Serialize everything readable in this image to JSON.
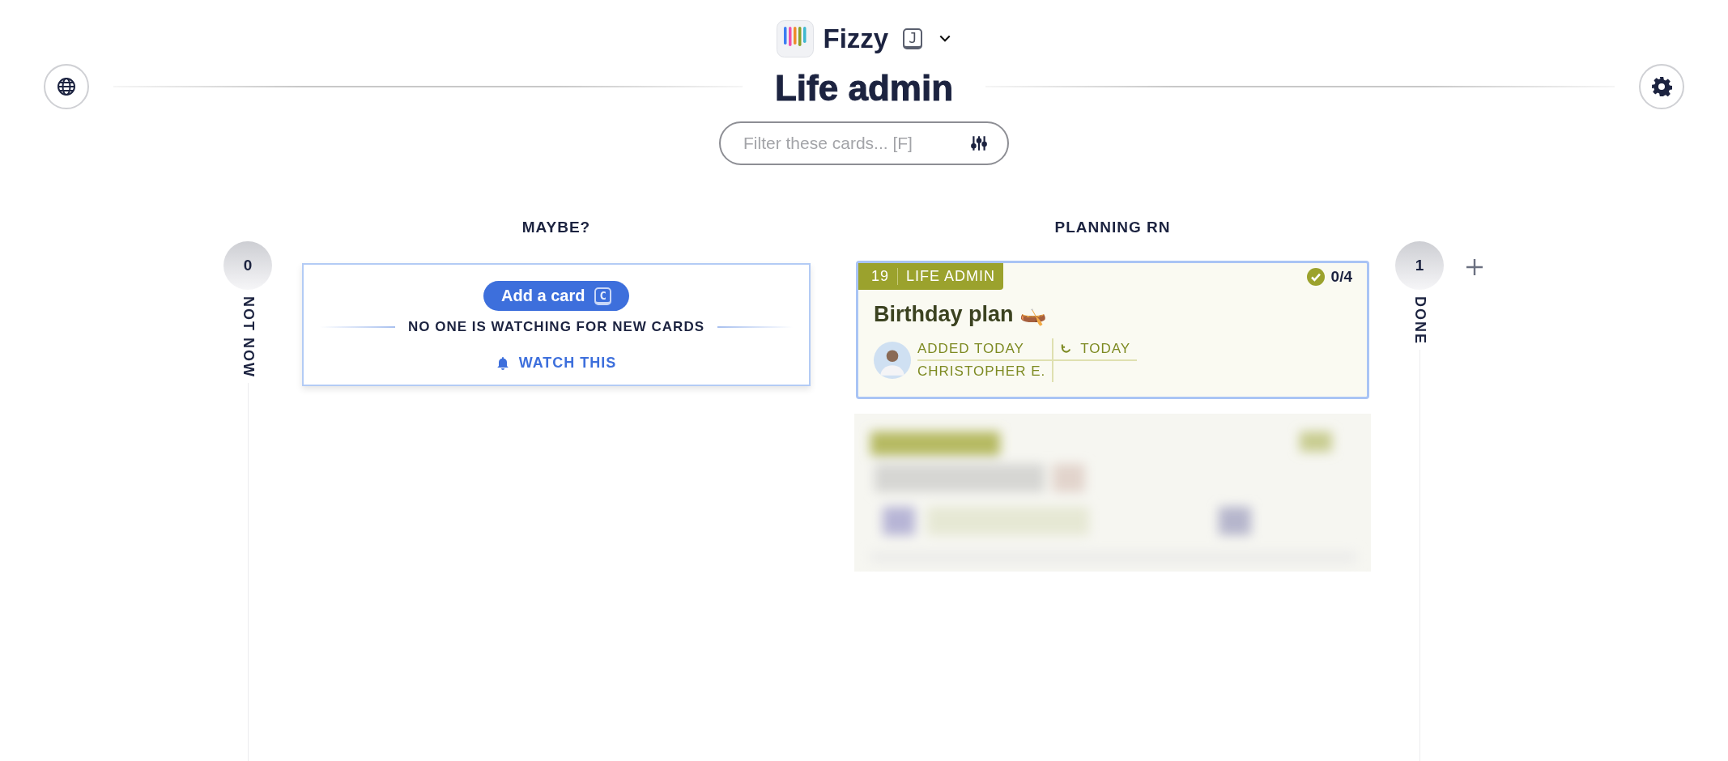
{
  "header": {
    "app_name": "Fizzy",
    "shortcut": "J",
    "board_title": "Life admin"
  },
  "filter": {
    "placeholder": "Filter these cards... [F]"
  },
  "columns": [
    {
      "kind": "collapsed",
      "name": "NOT NOW",
      "count": "0"
    },
    {
      "kind": "open",
      "name": "MAYBE?",
      "add_button": "Add a card",
      "add_shortcut": "C",
      "watch_notice": "NO ONE IS WATCHING FOR NEW CARDS",
      "watch_link": "WATCH THIS"
    },
    {
      "kind": "open",
      "name": "PLANNING RN",
      "cards": [
        {
          "kind": "card",
          "number": "19",
          "tag": "LIFE ADMIN",
          "steps": "0/4",
          "title": "Birthday plan 🛶",
          "added": "ADDED TODAY",
          "author": "CHRISTOPHER E.",
          "due": "TODAY"
        },
        {
          "kind": "picture"
        }
      ]
    },
    {
      "kind": "collapsed",
      "name": "DONE",
      "count": "1"
    }
  ]
}
